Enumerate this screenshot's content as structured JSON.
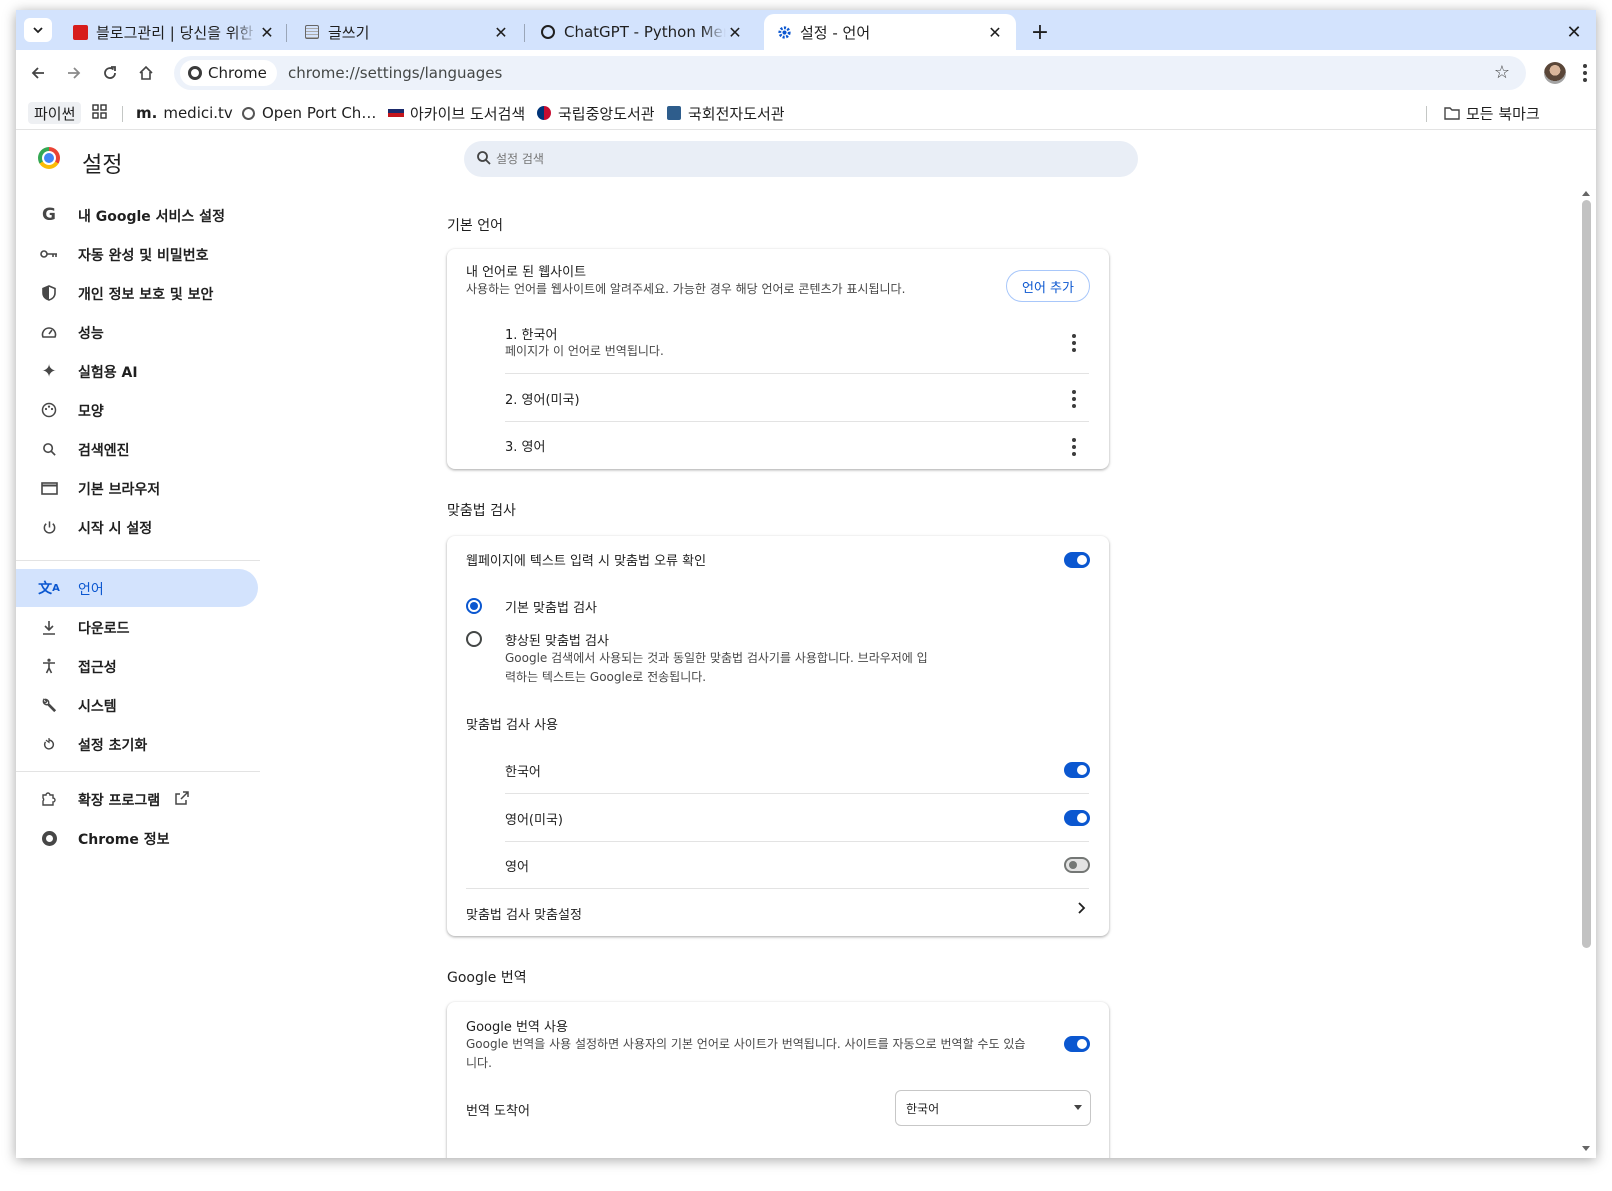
{
  "tabs": [
    {
      "title": "블로그관리 | 당신을 위한 E",
      "favicon": "red-favicon",
      "active": false
    },
    {
      "title": "글쓰기",
      "favicon": "page-favicon",
      "active": false
    },
    {
      "title": "ChatGPT - Python Ment",
      "favicon": "openai-favicon",
      "active": false
    },
    {
      "title": "설정 - 언어",
      "favicon": "gear-favicon",
      "active": true
    }
  ],
  "toolbar": {
    "chip_label": "Chrome",
    "url": "chrome://settings/languages"
  },
  "bookmarks": {
    "items": [
      {
        "label": "파이썬"
      },
      {
        "label": "medici.tv",
        "prefix": "m."
      },
      {
        "label": "Open Port Ch…"
      },
      {
        "label": "아카이브 도서검색"
      },
      {
        "label": "국립중앙도서관"
      },
      {
        "label": "국회전자도서관"
      }
    ],
    "all_bookmarks": "모든 북마크"
  },
  "settings": {
    "title": "설정",
    "search_placeholder": "설정 검색"
  },
  "sidebar": {
    "items": [
      {
        "label": "내 Google 서비스 설정",
        "icon": "google-icon"
      },
      {
        "label": "자동 완성 및 비밀번호",
        "icon": "key-icon"
      },
      {
        "label": "개인 정보 보호 및 보안",
        "icon": "shield-icon"
      },
      {
        "label": "성능",
        "icon": "speedometer-icon"
      },
      {
        "label": "실험용 AI",
        "icon": "sparkle-icon"
      },
      {
        "label": "모양",
        "icon": "palette-icon"
      },
      {
        "label": "검색엔진",
        "icon": "search-icon"
      },
      {
        "label": "기본 브라우저",
        "icon": "browser-icon"
      },
      {
        "label": "시작 시 설정",
        "icon": "power-icon"
      },
      {
        "label": "언어",
        "icon": "translate-icon",
        "active": true
      },
      {
        "label": "다운로드",
        "icon": "download-icon"
      },
      {
        "label": "접근성",
        "icon": "accessibility-icon"
      },
      {
        "label": "시스템",
        "icon": "wrench-icon"
      },
      {
        "label": "설정 초기화",
        "icon": "reset-icon"
      },
      {
        "label": "확장 프로그램",
        "icon": "extension-icon"
      },
      {
        "label": "Chrome 정보",
        "icon": "chrome-icon"
      }
    ]
  },
  "preferred": {
    "section_title": "기본 언어",
    "heading": "내 언어로 된 웹사이트",
    "description": "사용하는 언어를 웹사이트에 알려주세요. 가능한 경우 해당 언어로 콘텐츠가 표시됩니다.",
    "add_button": "언어 추가",
    "languages": [
      {
        "label": "1. 한국어",
        "sub": "페이지가 이 언어로 번역됩니다."
      },
      {
        "label": "2. 영어(미국)"
      },
      {
        "label": "3. 영어"
      }
    ]
  },
  "spellcheck": {
    "section_title": "맞춤법 검사",
    "toggle_label": "웹페이지에 텍스트 입력 시 맞춤법 오류 확인",
    "toggle_on": true,
    "basic_label": "기본 맞춤법 검사",
    "enhanced_label": "향상된 맞춤법 검사",
    "enhanced_desc_1": "Google 검색에서 사용되는 것과 동일한 맞춤법 검사기를 사용합니다. 브라우저에 입",
    "enhanced_desc_2": "력하는 텍스트는 Google로 전송됩니다.",
    "selected": "basic",
    "use_title": "맞춤법 검사 사용",
    "languages": [
      {
        "label": "한국어",
        "on": true
      },
      {
        "label": "영어(미국)",
        "on": true
      },
      {
        "label": "영어",
        "on": false
      }
    ],
    "customize_label": "맞춤법 검사 맞춤설정"
  },
  "translate": {
    "section_title": "Google 번역",
    "heading": "Google 번역 사용",
    "desc_1": "Google 번역을 사용 설정하면 사용자의 기본 언어로 사이트가 번역됩니다. 사이트를 자동으로 번역할 수도 있습",
    "desc_2": "니다.",
    "toggle_on": true,
    "target_label": "번역 도착어",
    "target_value": "한국어"
  },
  "colors": {
    "accent": "#0b57d0",
    "active_nav_bg": "#d3e3fd",
    "tabstrip_bg": "#d3e3fd"
  }
}
